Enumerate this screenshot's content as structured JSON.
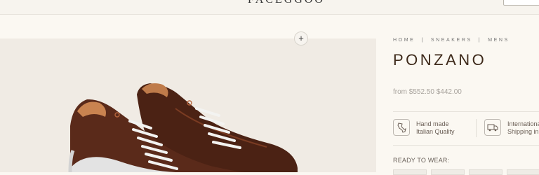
{
  "header": {
    "brand_name": "FACEGGOO",
    "account_button_label": ""
  },
  "gallery": {
    "zoom_label": "+"
  },
  "product": {
    "breadcrumb": [
      "HOME",
      "SNEAKERS",
      "MENS"
    ],
    "breadcrumb_separator": "|",
    "title": "PONZANO",
    "price_prefix": "from",
    "price_old": "$552.50",
    "price_new": "$442.00",
    "features": [
      {
        "line1": "Hand made",
        "line2": "Italian Quality",
        "icon": "italy-map-icon"
      },
      {
        "line1": "International",
        "line2": "Shipping in",
        "icon": "truck-icon"
      }
    ],
    "ready_to_wear_label": "READY TO WEAR:"
  },
  "colors": {
    "background": "#fbf8f2",
    "image_panel": "#f0ebe4",
    "title": "#3e2a1b",
    "leather": "#5a2a1a",
    "sole": "#dcdcdc"
  }
}
